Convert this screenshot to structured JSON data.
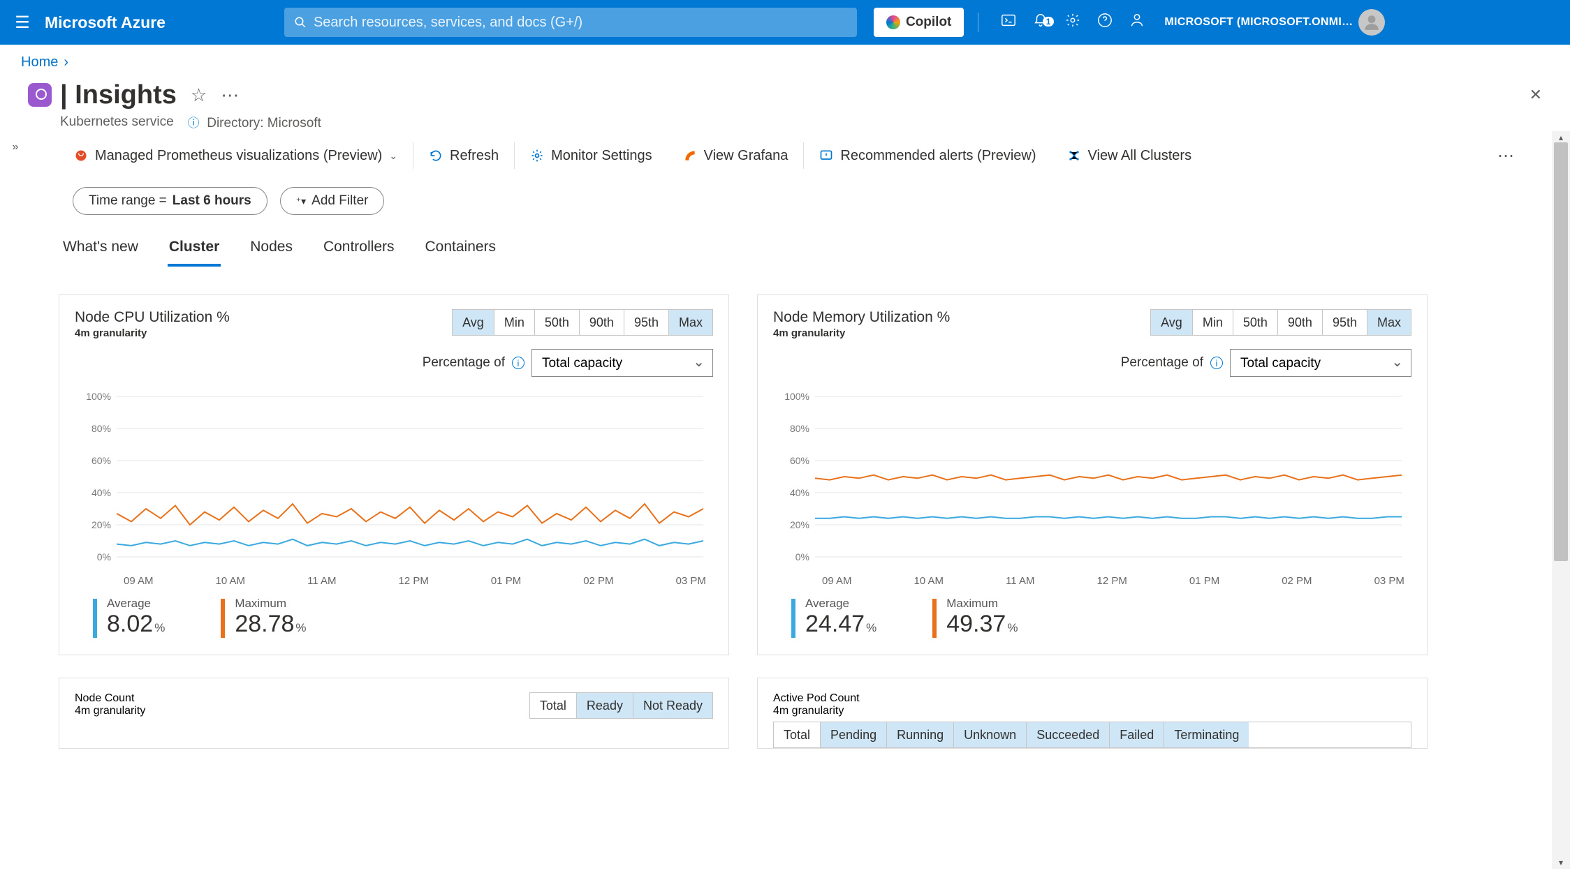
{
  "topbar": {
    "brand": "Microsoft Azure",
    "search_placeholder": "Search resources, services, and docs (G+/)",
    "copilot": "Copilot",
    "notification_count": "1",
    "account": "MICROSOFT (MICROSOFT.ONMI…"
  },
  "breadcrumb": {
    "home": "Home"
  },
  "page": {
    "title": "| Insights",
    "subtitle": "Kubernetes service",
    "directory_label": "Directory: Microsoft"
  },
  "toolbar": {
    "prom": "Managed Prometheus visualizations (Preview)",
    "refresh": "Refresh",
    "monitor": "Monitor Settings",
    "grafana": "View Grafana",
    "alerts": "Recommended alerts (Preview)",
    "clusters": "View All Clusters"
  },
  "filters": {
    "time_label": "Time range = ",
    "time_value": "Last 6 hours",
    "add_filter": "Add Filter"
  },
  "tabs": {
    "whatsnew": "What's new",
    "cluster": "Cluster",
    "nodes": "Nodes",
    "controllers": "Controllers",
    "containers": "Containers"
  },
  "agg_labels": {
    "avg": "Avg",
    "min": "Min",
    "p50": "50th",
    "p90": "90th",
    "p95": "95th",
    "max": "Max"
  },
  "perc": {
    "label": "Percentage of",
    "selected": "Total capacity"
  },
  "xticks": [
    "09 AM",
    "10 AM",
    "11 AM",
    "12 PM",
    "01 PM",
    "02 PM",
    "03 PM"
  ],
  "card1": {
    "title": "Node CPU Utilization %",
    "gran": "4m granularity",
    "avg_lbl": "Average",
    "avg_val": "8.02",
    "avg_unit": "%",
    "max_lbl": "Maximum",
    "max_val": "28.78",
    "max_unit": "%"
  },
  "card2": {
    "title": "Node Memory Utilization %",
    "gran": "4m granularity",
    "avg_lbl": "Average",
    "avg_val": "24.47",
    "avg_unit": "%",
    "max_lbl": "Maximum",
    "max_val": "49.37",
    "max_unit": "%"
  },
  "card3": {
    "title": "Node Count",
    "gran": "4m granularity",
    "seg": {
      "total": "Total",
      "ready": "Ready",
      "notready": "Not Ready"
    }
  },
  "card4": {
    "title": "Active Pod Count",
    "gran": "4m granularity",
    "seg": {
      "total": "Total",
      "pending": "Pending",
      "running": "Running",
      "unknown": "Unknown",
      "succeeded": "Succeeded",
      "failed": "Failed",
      "terminating": "Terminating"
    }
  },
  "chart_data": [
    {
      "type": "line",
      "title": "Node CPU Utilization %",
      "xlabel": "",
      "ylabel": "%",
      "ylim": [
        0,
        100
      ],
      "x": [
        "09 AM",
        "10 AM",
        "11 AM",
        "12 PM",
        "01 PM",
        "02 PM",
        "03 PM"
      ],
      "series": [
        {
          "name": "Maximum",
          "color": "#e8711a",
          "values": [
            27,
            22,
            30,
            24,
            32,
            20,
            28,
            23,
            31,
            22,
            29,
            24,
            33,
            21,
            27,
            25,
            30,
            22,
            28,
            24,
            31,
            21,
            29,
            23,
            30,
            22,
            28,
            25,
            32,
            21,
            27,
            23,
            31,
            22,
            29,
            24,
            33,
            21,
            28,
            25,
            30
          ]
        },
        {
          "name": "Average",
          "color": "#3aa9e0",
          "values": [
            8,
            7,
            9,
            8,
            10,
            7,
            9,
            8,
            10,
            7,
            9,
            8,
            11,
            7,
            9,
            8,
            10,
            7,
            9,
            8,
            10,
            7,
            9,
            8,
            10,
            7,
            9,
            8,
            11,
            7,
            9,
            8,
            10,
            7,
            9,
            8,
            11,
            7,
            9,
            8,
            10
          ]
        }
      ],
      "summary": {
        "Average": 8.02,
        "Maximum": 28.78
      }
    },
    {
      "type": "line",
      "title": "Node Memory Utilization %",
      "xlabel": "",
      "ylabel": "%",
      "ylim": [
        0,
        100
      ],
      "x": [
        "09 AM",
        "10 AM",
        "11 AM",
        "12 PM",
        "01 PM",
        "02 PM",
        "03 PM"
      ],
      "series": [
        {
          "name": "Maximum",
          "color": "#e8711a",
          "values": [
            49,
            48,
            50,
            49,
            51,
            48,
            50,
            49,
            51,
            48,
            50,
            49,
            51,
            48,
            49,
            50,
            51,
            48,
            50,
            49,
            51,
            48,
            50,
            49,
            51,
            48,
            49,
            50,
            51,
            48,
            50,
            49,
            51,
            48,
            50,
            49,
            51,
            48,
            49,
            50,
            51
          ]
        },
        {
          "name": "Average",
          "color": "#3aa9e0",
          "values": [
            24,
            24,
            25,
            24,
            25,
            24,
            25,
            24,
            25,
            24,
            25,
            24,
            25,
            24,
            24,
            25,
            25,
            24,
            25,
            24,
            25,
            24,
            25,
            24,
            25,
            24,
            24,
            25,
            25,
            24,
            25,
            24,
            25,
            24,
            25,
            24,
            25,
            24,
            24,
            25,
            25
          ]
        }
      ],
      "summary": {
        "Average": 24.47,
        "Maximum": 49.37
      }
    }
  ]
}
